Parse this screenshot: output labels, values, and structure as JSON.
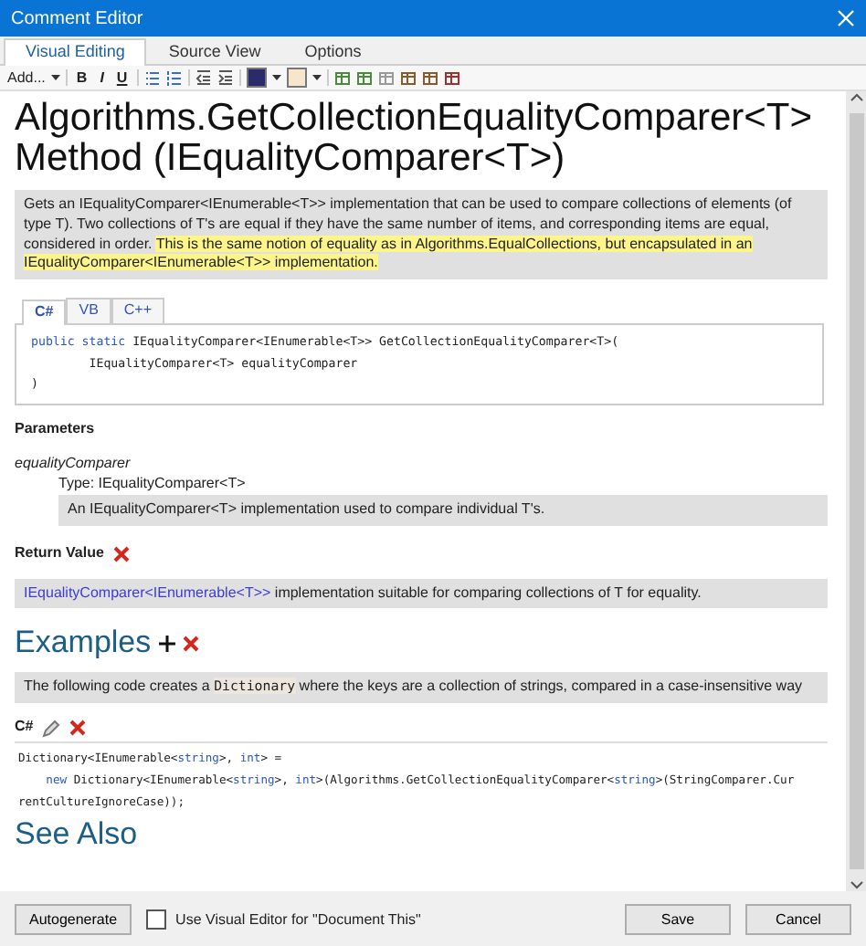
{
  "window": {
    "title": "Comment Editor"
  },
  "tabs": [
    {
      "label": "Visual Editing",
      "selected": true
    },
    {
      "label": "Source View",
      "selected": false
    },
    {
      "label": "Options",
      "selected": false
    }
  ],
  "toolbar": {
    "add_menu": "Add...",
    "format_buttons": [
      "B",
      "I",
      "U"
    ],
    "colors": [
      {
        "color": "#2b2a6b"
      },
      {
        "color": "#f6e7cc"
      }
    ]
  },
  "document": {
    "title": "Algorithms.GetCollectionEqualityComparer<T> Method (IEqualityComparer<T>)",
    "summary": [
      {
        "text": "Gets an IEqualityComparer<IEnumerable<T>> implementation that can be used to compare collections of elements (of type T). Two collections of T's are equal if they have the same number of items, and corresponding items are equal, considered in order. ",
        "highlight": false
      },
      {
        "text": "This is the same notion of equality as in Algorithms.EqualCollections, but encapsulated in an IEqualityComparer<IEnumerable<T>> implementation.",
        "highlight": true
      }
    ],
    "language_tabs": [
      {
        "label": "C#",
        "selected": true
      },
      {
        "label": "VB",
        "selected": false
      },
      {
        "label": "C++",
        "selected": false
      }
    ],
    "syntax": [
      [
        {
          "text": "public static ",
          "kind": "keyword"
        },
        {
          "text": "IEqualityComparer<IEnumerable<T>> GetCollectionEqualityComparer<T>(",
          "kind": "plain"
        }
      ],
      [
        {
          "text": "        IEqualityComparer<T> equalityComparer",
          "kind": "plain"
        }
      ],
      [
        {
          "text": ")",
          "kind": "plain"
        }
      ]
    ],
    "parameters_heading": "Parameters",
    "parameter": {
      "name": "equalityComparer",
      "type": "Type: IEqualityComparer<T>",
      "description": "An IEqualityComparer<T> implementation used to compare individual T's."
    },
    "return_heading": "Return Value",
    "return_value": [
      {
        "text": "IEqualityComparer<IEnumerable<T>>",
        "kind": "link"
      },
      {
        "text": " implementation suitable for comparing collections of T for equality.",
        "kind": "plain"
      }
    ],
    "examples_heading": "Examples",
    "example_description": [
      {
        "text": "The following code creates a ",
        "kind": "plain"
      },
      {
        "text": "Dictionary",
        "kind": "code"
      },
      {
        "text": " where the keys are a collection of strings, compared in a case-insensitive way",
        "kind": "plain"
      }
    ],
    "example_language": "C#",
    "example_code": [
      [
        {
          "text": "Dictionary<IEnumerable<",
          "kind": "plain"
        },
        {
          "text": "string",
          "kind": "keyword"
        },
        {
          "text": ">, ",
          "kind": "plain"
        },
        {
          "text": "int",
          "kind": "keyword"
        },
        {
          "text": "> =",
          "kind": "plain"
        }
      ],
      [
        {
          "text": "    new ",
          "kind": "keyword"
        },
        {
          "text": "Dictionary<IEnumerable<",
          "kind": "plain"
        },
        {
          "text": "string",
          "kind": "keyword"
        },
        {
          "text": ">, ",
          "kind": "plain"
        },
        {
          "text": "int",
          "kind": "keyword"
        },
        {
          "text": ">(Algorithms.GetCollectionEqualityComparer<",
          "kind": "plain"
        },
        {
          "text": "string",
          "kind": "keyword"
        },
        {
          "text": ">(StringComparer.Cur",
          "kind": "plain"
        }
      ],
      [
        {
          "text": "rentCultureIgnoreCase));",
          "kind": "plain"
        }
      ]
    ],
    "see_also_heading": "See Also"
  },
  "footer": {
    "autogenerate": "Autogenerate",
    "checkbox": {
      "label": "Use Visual Editor for \"Document This\"",
      "checked": false
    },
    "buttons": [
      "Save",
      "Cancel"
    ]
  }
}
